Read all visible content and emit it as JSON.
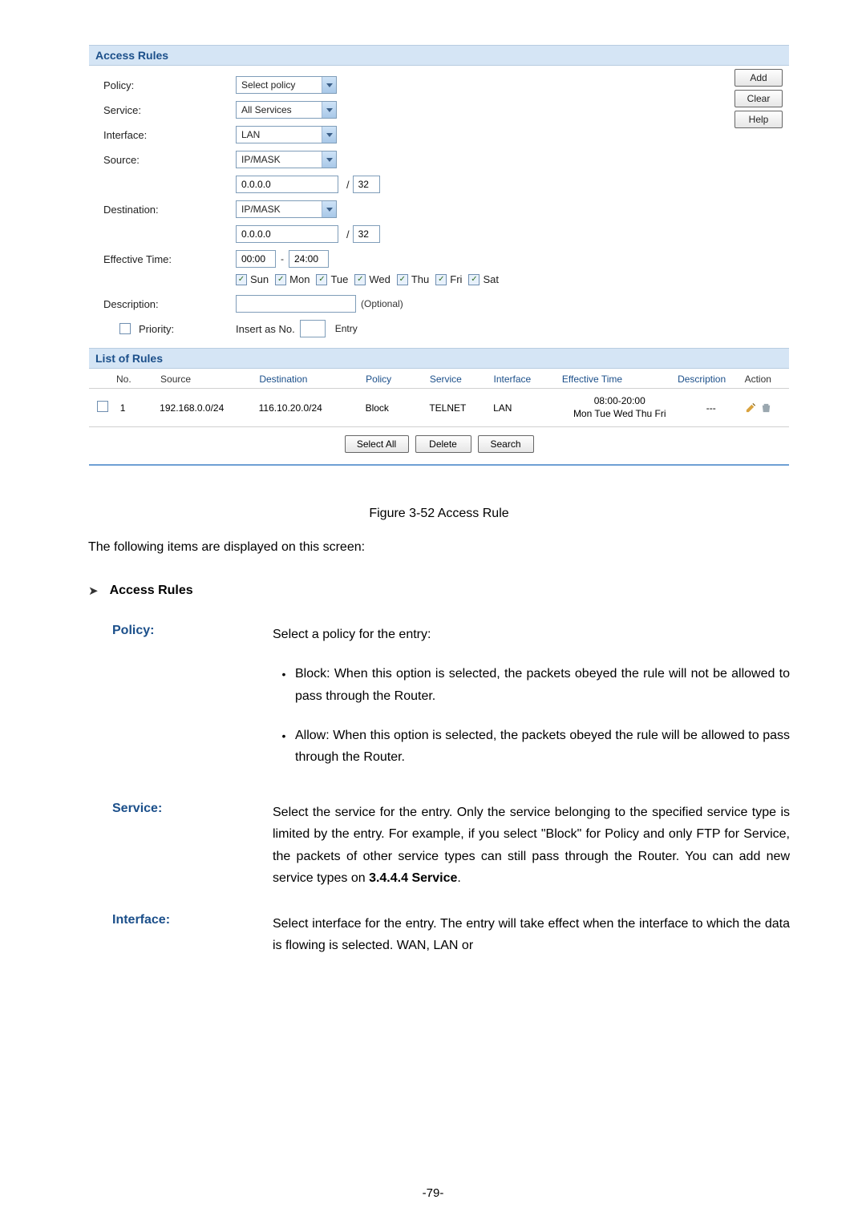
{
  "panel": {
    "title": "Access Rules",
    "buttons": {
      "add": "Add",
      "clear": "Clear",
      "help": "Help"
    },
    "form": {
      "policy_label": "Policy:",
      "policy_value": "Select policy",
      "service_label": "Service:",
      "service_value": "All Services",
      "interface_label": "Interface:",
      "interface_value": "LAN",
      "source_label": "Source:",
      "source_mode": "IP/MASK",
      "source_ip": "0.0.0.0",
      "source_mask": "32",
      "dest_label": "Destination:",
      "dest_mode": "IP/MASK",
      "dest_ip": "0.0.0.0",
      "dest_mask": "32",
      "time_label": "Effective Time:",
      "time_from": "00:00",
      "time_to": "24:00",
      "days": [
        "Sun",
        "Mon",
        "Tue",
        "Wed",
        "Thu",
        "Fri",
        "Sat"
      ],
      "desc_label": "Description:",
      "desc_hint": "(Optional)",
      "priority_label": "Priority:",
      "priority_prefix": "Insert as No.",
      "priority_suffix": "Entry"
    },
    "list_title": "List of Rules",
    "headers": {
      "no": "No.",
      "source": "Source",
      "dest": "Destination",
      "policy": "Policy",
      "service": "Service",
      "iface": "Interface",
      "eff": "Effective Time",
      "desc": "Description",
      "action": "Action"
    },
    "row": {
      "no": "1",
      "source": "192.168.0.0/24",
      "dest": "116.10.20.0/24",
      "policy": "Block",
      "service": "TELNET",
      "iface": "LAN",
      "eff1": "08:00-20:00",
      "eff2": "Mon Tue Wed Thu Fri",
      "desc": "---"
    },
    "bottom": {
      "select_all": "Select All",
      "delete": "Delete",
      "search": "Search"
    }
  },
  "caption": "Figure 3-52 Access Rule",
  "intro": "The following items are displayed on this screen:",
  "subhead": "Access Rules",
  "defs": {
    "policy_term": "Policy:",
    "policy_desc": "Select a policy for the entry:",
    "policy_b1": "Block: When this option is selected, the packets obeyed the rule will not be allowed to pass through the Router.",
    "policy_b2": "Allow: When this option is selected, the packets obeyed the rule will be allowed to pass through the Router.",
    "service_term": "Service:",
    "service_desc_a": "Select the service for the entry. Only the service belonging to the specified service type is limited by the entry. For example, if you select \"Block\" for Policy and only FTP for Service, the packets of other service types can still pass through the Router. You can add new service types on ",
    "service_desc_b": "3.4.4.4 Service",
    "service_desc_c": ".",
    "interface_term": "Interface:",
    "interface_desc": "Select interface for the entry. The entry will take effect when the interface to which the data is flowing is selected. WAN, LAN or"
  },
  "pagenum": "-79-"
}
